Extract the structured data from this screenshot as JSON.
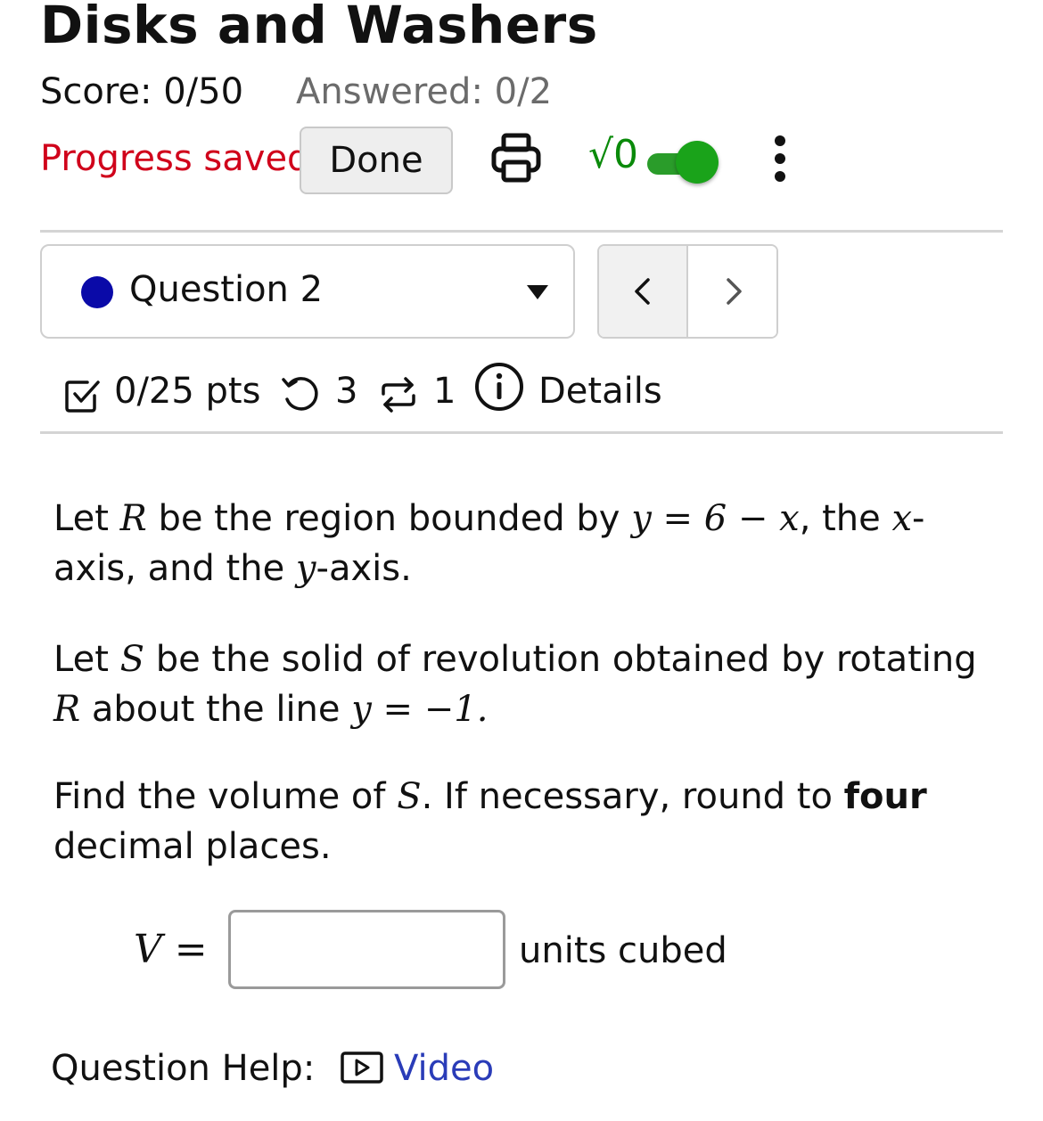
{
  "header": {
    "title": "Disks and Washers",
    "score": "Score: 0/50",
    "answered": "Answered: 0/2",
    "progress": "Progress saved",
    "done_label": "Done",
    "math_toggle_label": "√0",
    "math_toggle_on": true
  },
  "question_nav": {
    "selected": "Question 2",
    "status_color": "#0a0aa8"
  },
  "question_info": {
    "points": "0/25 pts",
    "retries": "3",
    "attempts": "1",
    "details": "Details"
  },
  "problem": {
    "p1": {
      "let": "Let",
      "R": "R",
      "t1": "be the region bounded by",
      "eq": "y = 6 − x",
      "t2": ", the",
      "x": "x",
      "t3": "-axis, and the",
      "y": "y",
      "t4": "-axis."
    },
    "p2": {
      "let": "Let",
      "S": "S",
      "t1": "be the solid of revolution obtained by rotating",
      "R": "R",
      "t2": "about the line",
      "eq": "y = −1."
    },
    "p3": {
      "t1": "Find the volume of",
      "S": "S",
      "t2": ". If necessary, round to",
      "bold": "four",
      "t3": "decimal places."
    }
  },
  "answer": {
    "label": "V =",
    "value": "",
    "units": "units cubed"
  },
  "help": {
    "label": "Question Help:",
    "video": "Video"
  },
  "colors": {
    "progress_red": "#d0021b",
    "toggle_green": "#1aa31a",
    "link_blue": "#2a3cb8",
    "question_dot": "#0a0aa8"
  }
}
